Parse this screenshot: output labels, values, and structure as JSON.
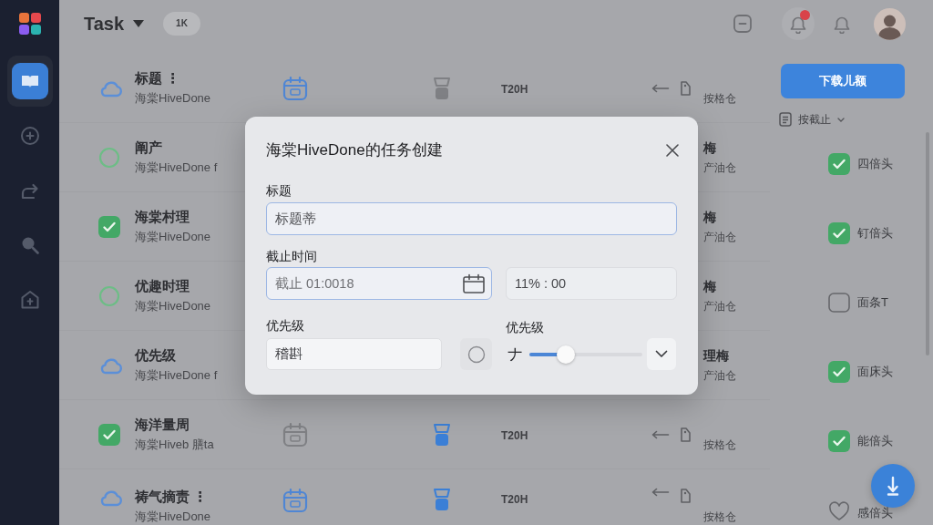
{
  "sidebar": {
    "items": [
      {
        "selected": true
      },
      {
        "selected": false
      },
      {
        "selected": false
      },
      {
        "selected": false
      },
      {
        "selected": false
      }
    ]
  },
  "topbar": {
    "title": "Task",
    "badge": "1K",
    "notification_dot": true
  },
  "tasks": [
    {
      "kind": "cloud",
      "title": "标题 ⋮",
      "subtitle": "海棠HiveDone",
      "due_set": true,
      "flagged": false,
      "duration": "T20H",
      "note": "按格仓"
    },
    {
      "kind": "open",
      "title": "阐产",
      "subtitle": "海棠HiveDone f",
      "owner": "梅",
      "note": "产油仓"
    },
    {
      "kind": "done",
      "title": "海棠村理",
      "subtitle": "海棠HiveDone",
      "owner": "梅",
      "note": "产油仓"
    },
    {
      "kind": "open",
      "title": "优趣时理",
      "subtitle": "海棠HiveDone",
      "owner": "梅",
      "note": "产油仓"
    },
    {
      "kind": "cloud",
      "title": "优先级",
      "subtitle": "海棠HiveDone f",
      "owner": "理梅",
      "note": "产油仓"
    },
    {
      "kind": "done",
      "title": "海洋量周",
      "subtitle": "海棠Hiveb 膳ta",
      "due_set": false,
      "flagged": true,
      "duration": "T20H",
      "note": "按格仓"
    },
    {
      "kind": "cloud",
      "title": "祷气摘责 ⋮",
      "subtitle": "海棠HiveDone",
      "due_set": true,
      "flagged": true,
      "duration": "T20H",
      "note": "按格仓"
    }
  ],
  "side_panel": {
    "button": "下载儿额",
    "sort": "按截止",
    "checklist": [
      {
        "kind": "checkbox",
        "checked": true,
        "label": "四倍头"
      },
      {
        "kind": "checkbox",
        "checked": true,
        "label": "钉倍头"
      },
      {
        "kind": "checkbox",
        "checked": false,
        "label": "面条T"
      },
      {
        "kind": "checkbox",
        "checked": true,
        "label": "面床头"
      },
      {
        "kind": "checkbox",
        "checked": true,
        "label": "能倍头"
      },
      {
        "kind": "heart",
        "label": "感倍头"
      }
    ]
  },
  "dialog": {
    "title": "海棠HiveDone的任务创建",
    "title_field": {
      "label": "标题",
      "value": "标题蒂",
      "highlighted": true
    },
    "due": {
      "label": "截止时间",
      "date": {
        "placeholder": "截止 01:0018",
        "highlighted": true
      },
      "time": {
        "value": "11% : 00",
        "highlighted": false
      }
    },
    "priority": {
      "label": "优先级",
      "value": "稽斟"
    },
    "priority_slider": {
      "label": "优先级",
      "prefix": "ナ",
      "level": 0.32
    }
  }
}
